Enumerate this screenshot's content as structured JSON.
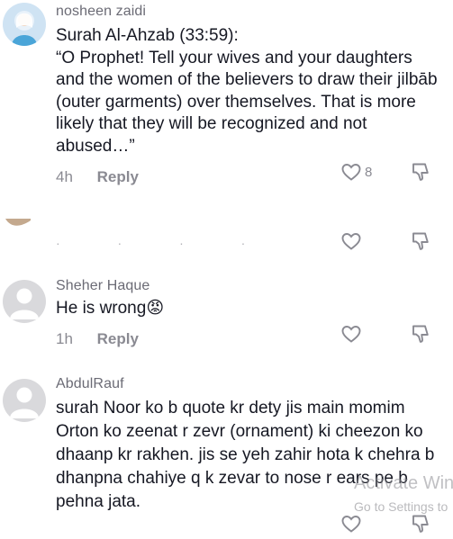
{
  "comments": [
    {
      "username": "nosheen zaidi",
      "text": "Surah Al-Ahzab (33:59):\n“O Prophet! Tell your wives and your daughters and the women of the believers to draw their jilbāb (outer garments) over themselves. That is more likely that they will be recognized and not abused…”",
      "time": "4h",
      "reply_label": "Reply",
      "likes": "8"
    },
    {
      "username": "Sheher Haque",
      "text": "He is wrong",
      "emoji": "😡",
      "time": "1h",
      "reply_label": "Reply"
    },
    {
      "username": "AbdulRauf",
      "text": "surah Noor ko b quote kr dety jis main momim Orton ko zeenat r zevr (ornament) ki cheezon ko dhaanp kr rakhen. jis se yeh zahir hota k chehra b dhanpna chahiye q k zevar to nose r ears pe b pehna jata."
    }
  ],
  "watermark": {
    "line1": "Activate Win",
    "line2": "Go to Settings to"
  },
  "icons": {
    "like": "heart-outline-icon",
    "dislike": "thumbs-down-outline-icon"
  }
}
